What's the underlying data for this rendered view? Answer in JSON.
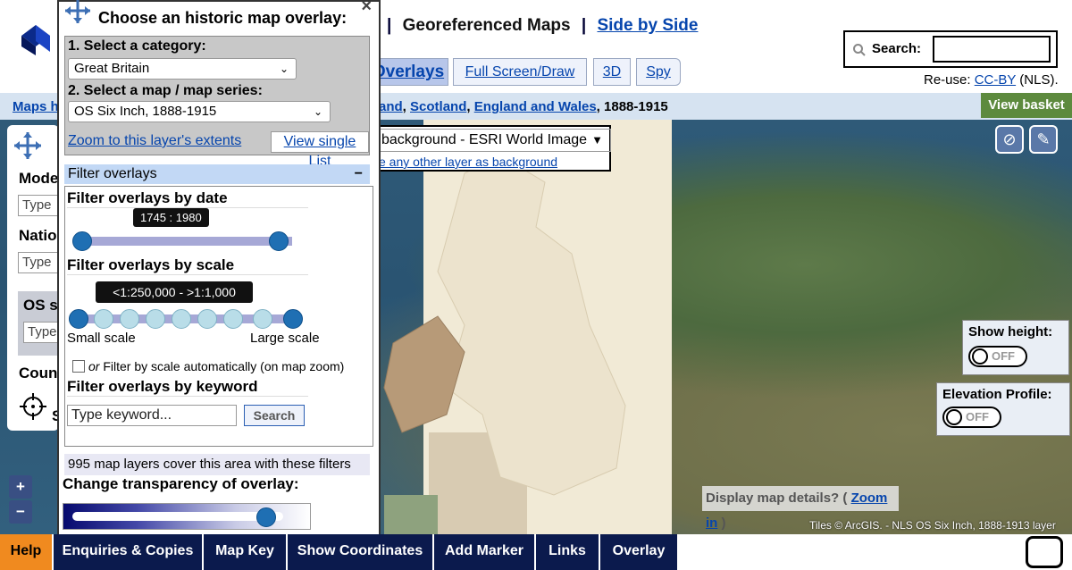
{
  "header": {
    "nav_separator": "|",
    "georef_label": "Georeferenced Maps",
    "side_by_side_label": "Side by Side",
    "search_label": "Search:",
    "search_value": "",
    "reuse_prefix": "Re-use:",
    "reuse_link": "CC-BY",
    "reuse_suffix": "(NLS).",
    "tabs": [
      "Overlays",
      "Full Screen/Draw",
      "3D",
      "Spy"
    ]
  },
  "breadcrumb": {
    "maps_home": "Maps h",
    "trail": [
      "and",
      "Scotland",
      "England and Wales"
    ],
    "trail_end": "1888-1915",
    "view_basket": "View basket"
  },
  "side_panel": {
    "labels": [
      "Mode",
      "Natio",
      "OS s",
      "Coun"
    ],
    "input_placeholder": "Type",
    "locate_label": "S"
  },
  "background": {
    "selected": "background - ESRI World Image",
    "link": "e any other layer as background"
  },
  "chooser": {
    "title": "Choose an historic map overlay:",
    "close": "×",
    "step1": "1. Select a category:",
    "category": "Great Britain",
    "step2": "2. Select a map / map series:",
    "series": "OS Six Inch, 1888-1915",
    "zoom_link": "Zoom to this layer's extents",
    "view_single": "View single List",
    "filter_header": "Filter overlays",
    "filter_minus": "−",
    "by_date": "Filter overlays by date",
    "date_tooltip": "1745 : 1980",
    "by_scale": "Filter overlays by scale",
    "scale_tooltip": "<1:250,000 - >1:1,000",
    "small_scale": "Small scale",
    "large_scale": "Large scale",
    "auto_scale_or": "or",
    "auto_scale": "Filter by scale automatically (on map zoom)",
    "by_keyword": "Filter overlays by keyword",
    "keyword_placeholder": "Type keyword...",
    "search_btn": "Search",
    "count_text": "995 map layers cover this area with these filters",
    "transparency": "Change transparency of overlay:",
    "transparency_value": 0.92
  },
  "map": {
    "show_height": "Show height:",
    "elevation": "Elevation Profile:",
    "toggle_off": "OFF",
    "details_prefix": "Display map details? (",
    "details_link": "Zoom in",
    "details_suffix": ")",
    "attribution": "Tiles © ArcGIS. - NLS OS Six Inch, 1888-1913 layer",
    "zoom_in": "+",
    "zoom_out": "−"
  },
  "bottom_tabs": [
    "Help",
    "Enquiries & Copies",
    "Map Key",
    "Show Coordinates",
    "Add Marker",
    "Links",
    "Overlay"
  ],
  "colors": {
    "accent": "#0b1a4d",
    "help": "#f08a1f",
    "basket": "#5d8a3e",
    "link": "#0645ad"
  }
}
